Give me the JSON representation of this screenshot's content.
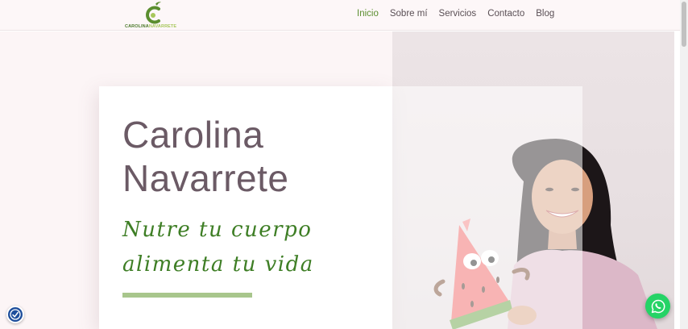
{
  "header": {
    "logo": {
      "name_first": "CAROLINA",
      "name_second": "NAVARRETE"
    },
    "nav": [
      "Inicio",
      "Sobre mí",
      "Servicios",
      "Contacto",
      "Blog"
    ],
    "active_index": 0
  },
  "hero": {
    "name_line1": "Carolina",
    "name_line2": "Navarrete",
    "slogan_line1": "Nutre tu cuerpo",
    "slogan_line2": "alimenta tu vida"
  },
  "colors": {
    "brand_green": "#5b8e2f",
    "text_mauve": "#6b5a65",
    "slogan_green": "#3e7e25",
    "whatsapp": "#25d366",
    "accessibility": "#1e4e9c"
  },
  "icons": {
    "logo": "apple-c-logo-icon",
    "accessibility": "accessibility-icon",
    "whatsapp": "whatsapp-icon"
  }
}
